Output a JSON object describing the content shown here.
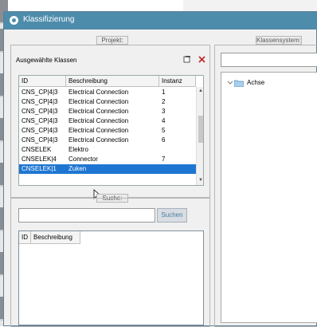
{
  "window": {
    "title": "Klassifizierung"
  },
  "project": {
    "legend": "Projekt:",
    "panel_title": "Ausgewählte Klassen",
    "columns": {
      "id": "ID",
      "beschreibung": "Beschreibung",
      "instanz": "Instanz"
    },
    "rows": [
      {
        "id": "CNS_CP|4|3",
        "beschreibung": "Electrical Connection",
        "instanz": "1"
      },
      {
        "id": "CNS_CP|4|3",
        "beschreibung": "Electrical Connection",
        "instanz": "2"
      },
      {
        "id": "CNS_CP|4|3",
        "beschreibung": "Electrical Connection",
        "instanz": "3"
      },
      {
        "id": "CNS_CP|4|3",
        "beschreibung": "Electrical Connection",
        "instanz": "4"
      },
      {
        "id": "CNS_CP|4|3",
        "beschreibung": "Electrical Connection",
        "instanz": "5"
      },
      {
        "id": "CNS_CP|4|3",
        "beschreibung": "Electrical Connection",
        "instanz": "6"
      },
      {
        "id": "CNSELEK",
        "beschreibung": "Elektro",
        "instanz": ""
      },
      {
        "id": "CNSELEK|4",
        "beschreibung": "Connector",
        "instanz": "7"
      },
      {
        "id": "CNSELEK|1",
        "beschreibung": "Zuken",
        "instanz": ""
      }
    ],
    "selected_row_index": 8
  },
  "search": {
    "legend": "Suche:",
    "input_value": "",
    "button_label": "Suchen",
    "columns": {
      "id": "ID",
      "beschreibung": "Beschreibung"
    }
  },
  "class_system": {
    "legend": "Klassensystem:",
    "tree_root": "Achse"
  },
  "colors": {
    "titlebar": "#4e8cab",
    "selection": "#1f76d2",
    "search_button_text": "#4b7ca0"
  }
}
